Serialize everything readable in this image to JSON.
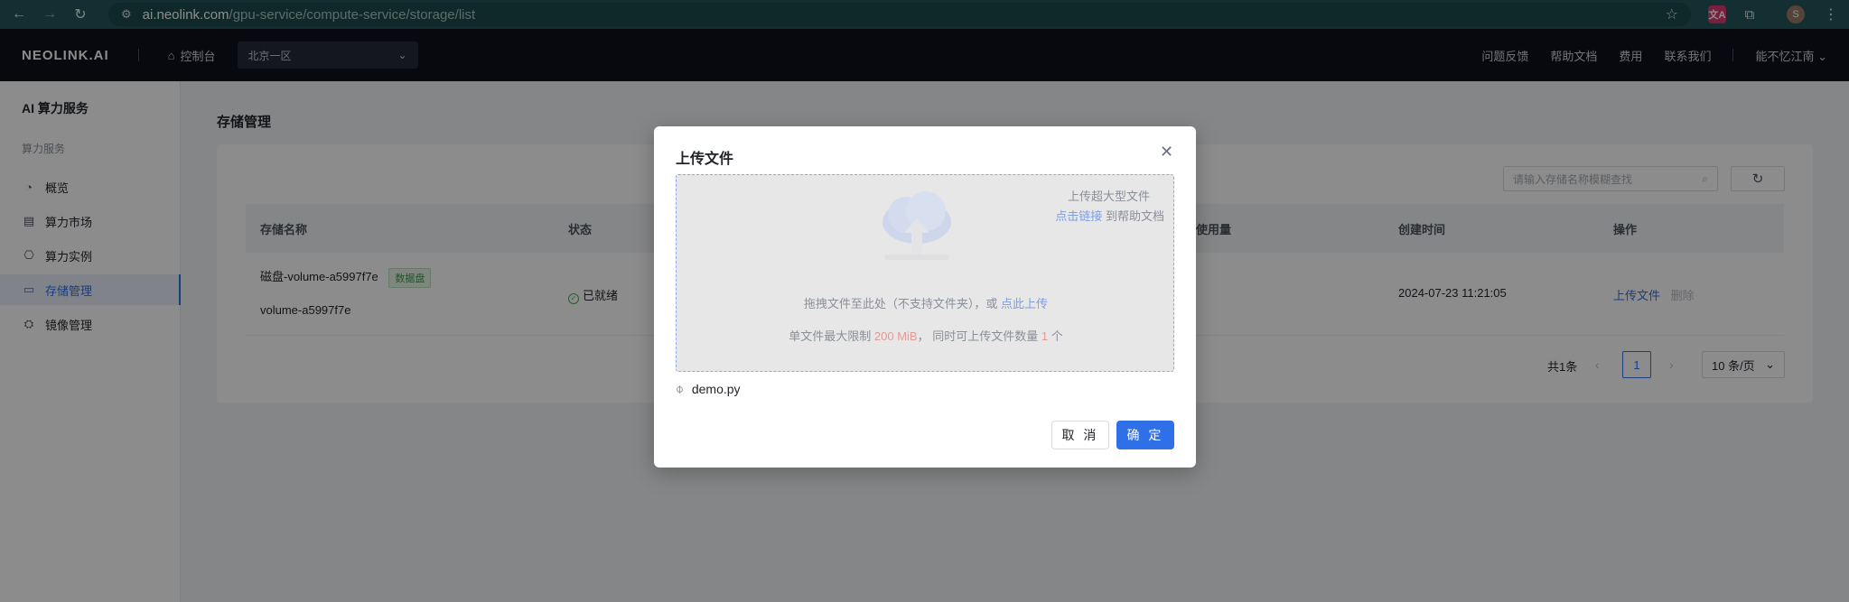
{
  "browser": {
    "url_host": "ai.neolink.com",
    "url_path": "/gpu-service/compute-service/storage/list",
    "ext_translate_label": "文A",
    "profile_initial": "S"
  },
  "header": {
    "logo": "NEOLINK.AI",
    "console": "控制台",
    "region": "北京一区",
    "links": [
      "问题反馈",
      "帮助文档",
      "费用",
      "联系我们"
    ],
    "user": "能不忆江南"
  },
  "sidebar": {
    "title": "AI 算力服务",
    "group": "算力服务",
    "items": [
      {
        "label": "概览",
        "icon": "dashboard-icon"
      },
      {
        "label": "算力市场",
        "icon": "store-icon"
      },
      {
        "label": "算力实例",
        "icon": "instance-icon"
      },
      {
        "label": "存储管理",
        "icon": "storage-icon"
      },
      {
        "label": "镜像管理",
        "icon": "image-icon"
      }
    ]
  },
  "main": {
    "title": "存储管理",
    "search_placeholder": "请输入存储名称模糊查找",
    "columns": [
      "存储名称",
      "状态",
      "使用量",
      "创建时间",
      "操作"
    ],
    "row": {
      "name": "磁盘-volume-a5997f7e",
      "tag": "数据盘",
      "sub_name": "volume-a5997f7e",
      "status": "已就绪",
      "created": "2024-07-23 11:21:05",
      "action_upload": "上传文件",
      "action_delete": "删除"
    },
    "pagination": {
      "total": "共1条",
      "current": "1",
      "page_size": "10 条/页"
    }
  },
  "modal": {
    "title": "上传文件",
    "hint_large": "上传超大型文件",
    "hint_link": "点击链接",
    "hint_link_suffix": " 到帮助文档",
    "drop_text": "拖拽文件至此处（不支持文件夹），或 ",
    "drop_link": "点此上传",
    "limit_prefix": "单文件最大限制 ",
    "limit_size": "200 MiB",
    "limit_mid": "， 同时可上传文件数量 ",
    "limit_count": "1",
    "limit_suffix": " 个",
    "file_name": "demo.py",
    "cancel": "取 消",
    "confirm": "确 定"
  },
  "colors": {
    "primary": "#2f6fe8",
    "header_bg": "#0d111c",
    "chrome_bg": "#23565a",
    "success": "#3fae55"
  }
}
